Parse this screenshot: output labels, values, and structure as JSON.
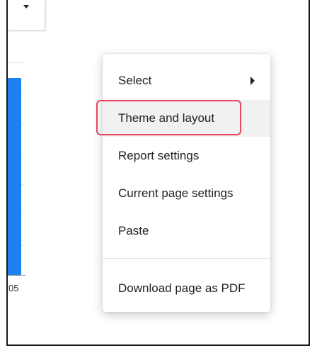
{
  "chart": {
    "axis_label": "05",
    "bar_color": "#1f80f2"
  },
  "context_menu": {
    "items": [
      {
        "label": "Select",
        "has_submenu": true,
        "icon": "caret-right-icon"
      },
      {
        "label": "Theme and layout",
        "highlighted": true
      },
      {
        "label": "Report settings"
      },
      {
        "label": "Current page settings"
      },
      {
        "label": "Paste"
      },
      {
        "label": "Download page as PDF"
      }
    ],
    "highlight_color": "#e3485e"
  },
  "toolbar": {
    "dropdown_icon": "caret-down-icon"
  }
}
